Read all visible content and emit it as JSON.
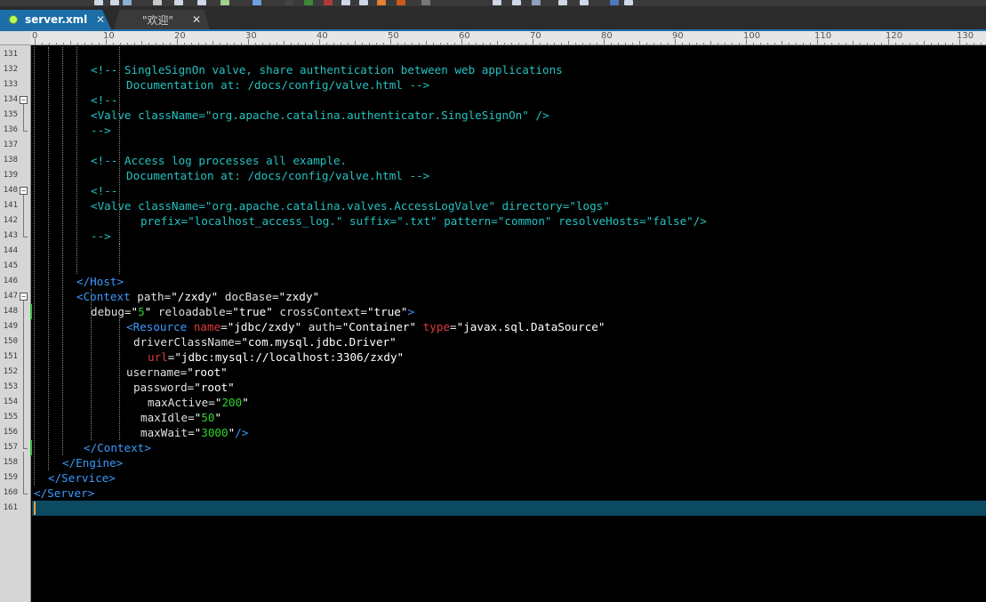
{
  "tabs": [
    {
      "label": "server.xml",
      "active": true,
      "close": "✕"
    },
    {
      "label": "\"欢迎\"",
      "active": false,
      "close": "✕"
    }
  ],
  "ruler": {
    "labels": [
      "0",
      "10",
      "20",
      "30",
      "40",
      "50",
      "60",
      "70",
      "80",
      "90",
      "100",
      "110",
      "120",
      "130"
    ]
  },
  "editor": {
    "lines": [
      {
        "n": "131",
        "tokens": []
      },
      {
        "n": "132",
        "tokens": [
          {
            "t": "<!-- SingleSignOn valve, share authentication between web applications",
            "c": "c-comment"
          }
        ]
      },
      {
        "n": "133",
        "tokens": [
          {
            "t": "Documentation at: /docs/config/valve.html -->",
            "c": "c-comment"
          }
        ]
      },
      {
        "n": "134",
        "tokens": [
          {
            "t": "<!--",
            "c": "c-comment"
          }
        ]
      },
      {
        "n": "135",
        "tokens": [
          {
            "t": "<Valve className=\"org.apache.catalina.authenticator.SingleSignOn\" />",
            "c": "c-comment"
          }
        ]
      },
      {
        "n": "136",
        "tokens": [
          {
            "t": "-->",
            "c": "c-comment"
          }
        ]
      },
      {
        "n": "137",
        "tokens": []
      },
      {
        "n": "138",
        "tokens": [
          {
            "t": "<!-- Access log processes all example.",
            "c": "c-comment"
          }
        ]
      },
      {
        "n": "139",
        "tokens": [
          {
            "t": "Documentation at: /docs/config/valve.html -->",
            "c": "c-comment"
          }
        ]
      },
      {
        "n": "140",
        "tokens": [
          {
            "t": "<!--",
            "c": "c-comment"
          }
        ]
      },
      {
        "n": "141",
        "tokens": [
          {
            "t": "<Valve className=\"org.apache.catalina.valves.AccessLogValve\" directory=\"logs\"",
            "c": "c-comment"
          }
        ]
      },
      {
        "n": "142",
        "tokens": [
          {
            "t": "prefix=\"localhost_access_log.\" suffix=\".txt\" pattern=\"common\" resolveHosts=\"false\"/>",
            "c": "c-comment"
          }
        ]
      },
      {
        "n": "143",
        "tokens": [
          {
            "t": "-->",
            "c": "c-comment"
          }
        ]
      },
      {
        "n": "144",
        "tokens": []
      },
      {
        "n": "145",
        "tokens": []
      },
      {
        "n": "146",
        "tokens": [
          {
            "t": "</Host>",
            "c": "c-tag"
          }
        ]
      },
      {
        "n": "147",
        "tokens": [
          {
            "t": "<Context",
            "c": "c-tag"
          },
          {
            "t": " path",
            "c": "c-attr"
          },
          {
            "t": "=",
            "c": "c-plain"
          },
          {
            "t": "\"/zxdy\"",
            "c": "c-str"
          },
          {
            "t": " docBase",
            "c": "c-attr"
          },
          {
            "t": "=",
            "c": "c-plain"
          },
          {
            "t": "\"zxdy\"",
            "c": "c-str"
          }
        ]
      },
      {
        "n": "148",
        "tokens": [
          {
            "t": "debug",
            "c": "c-attr"
          },
          {
            "t": "=",
            "c": "c-plain"
          },
          {
            "t": "\"",
            "c": "c-str"
          },
          {
            "t": "5",
            "c": "c-num"
          },
          {
            "t": "\"",
            "c": "c-str"
          },
          {
            "t": " reloadable",
            "c": "c-attr"
          },
          {
            "t": "=",
            "c": "c-plain"
          },
          {
            "t": "\"true\"",
            "c": "c-str"
          },
          {
            "t": " crossContext",
            "c": "c-attr"
          },
          {
            "t": "=",
            "c": "c-plain"
          },
          {
            "t": "\"true\"",
            "c": "c-str"
          },
          {
            "t": ">",
            "c": "c-tag"
          }
        ]
      },
      {
        "n": "149",
        "tokens": [
          {
            "t": "<Resource",
            "c": "c-tag"
          },
          {
            "t": " name",
            "c": "c-attr-red"
          },
          {
            "t": "=",
            "c": "c-plain"
          },
          {
            "t": "\"jdbc/zxdy\"",
            "c": "c-str"
          },
          {
            "t": " auth",
            "c": "c-attr"
          },
          {
            "t": "=",
            "c": "c-plain"
          },
          {
            "t": "\"Container\"",
            "c": "c-str"
          },
          {
            "t": " type",
            "c": "c-attr-red"
          },
          {
            "t": "=",
            "c": "c-plain"
          },
          {
            "t": "\"javax.sql.DataSource\"",
            "c": "c-str"
          }
        ]
      },
      {
        "n": "150",
        "tokens": [
          {
            "t": "driverClassName",
            "c": "c-attr"
          },
          {
            "t": "=",
            "c": "c-plain"
          },
          {
            "t": "\"com.mysql.jdbc.Driver\"",
            "c": "c-str"
          }
        ]
      },
      {
        "n": "151",
        "tokens": [
          {
            "t": "url",
            "c": "c-attr-red"
          },
          {
            "t": "=",
            "c": "c-plain"
          },
          {
            "t": "\"jdbc:mysql://localhost:3306/zxdy\"",
            "c": "c-str"
          }
        ]
      },
      {
        "n": "152",
        "tokens": [
          {
            "t": "username",
            "c": "c-attr"
          },
          {
            "t": "=",
            "c": "c-plain"
          },
          {
            "t": "\"root\"",
            "c": "c-str"
          }
        ]
      },
      {
        "n": "153",
        "tokens": [
          {
            "t": "password",
            "c": "c-attr"
          },
          {
            "t": "=",
            "c": "c-plain"
          },
          {
            "t": "\"root\"",
            "c": "c-str"
          }
        ]
      },
      {
        "n": "154",
        "tokens": [
          {
            "t": "maxActive",
            "c": "c-attr"
          },
          {
            "t": "=",
            "c": "c-plain"
          },
          {
            "t": "\"",
            "c": "c-str"
          },
          {
            "t": "200",
            "c": "c-num"
          },
          {
            "t": "\"",
            "c": "c-str"
          }
        ]
      },
      {
        "n": "155",
        "tokens": [
          {
            "t": "maxIdle",
            "c": "c-attr"
          },
          {
            "t": "=",
            "c": "c-plain"
          },
          {
            "t": "\"",
            "c": "c-str"
          },
          {
            "t": "50",
            "c": "c-num"
          },
          {
            "t": "\"",
            "c": "c-str"
          }
        ]
      },
      {
        "n": "156",
        "tokens": [
          {
            "t": "maxWait",
            "c": "c-attr"
          },
          {
            "t": "=",
            "c": "c-plain"
          },
          {
            "t": "\"",
            "c": "c-str"
          },
          {
            "t": "3000",
            "c": "c-num"
          },
          {
            "t": "\"",
            "c": "c-str"
          },
          {
            "t": "/>",
            "c": "c-tag"
          }
        ]
      },
      {
        "n": "157",
        "tokens": [
          {
            "t": "</Context>",
            "c": "c-tag"
          }
        ]
      },
      {
        "n": "158",
        "tokens": [
          {
            "t": "</Engine>",
            "c": "c-tag"
          }
        ]
      },
      {
        "n": "159",
        "tokens": [
          {
            "t": "</Service>",
            "c": "c-tag"
          }
        ]
      },
      {
        "n": "160",
        "tokens": [
          {
            "t": "</Server>",
            "c": "c-tag"
          }
        ]
      },
      {
        "n": "161",
        "tokens": []
      }
    ]
  },
  "colors": {
    "comment": "#25c2c2",
    "tag": "#3a9cff",
    "number": "#2bd52b",
    "special_attr": "#e03a3a",
    "current_line": "#0c4a62",
    "active_tab": "#1b6ea8"
  }
}
